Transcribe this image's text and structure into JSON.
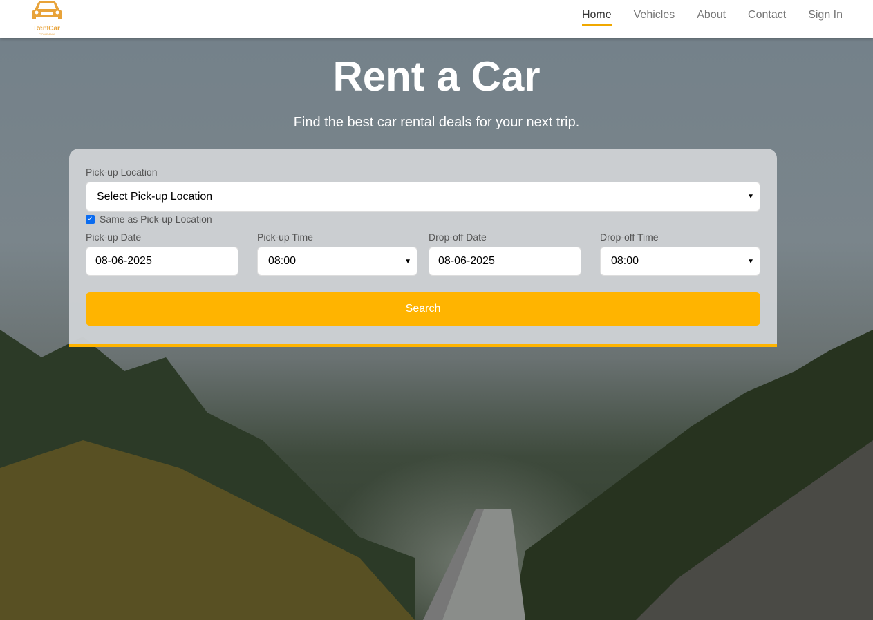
{
  "nav": {
    "logo_text_1": "Rent",
    "logo_text_2": "Car",
    "logo_sub": "COMPANY",
    "items": [
      {
        "label": "Home",
        "active": true
      },
      {
        "label": "Vehicles"
      },
      {
        "label": "About"
      },
      {
        "label": "Contact"
      },
      {
        "label": "Sign In"
      }
    ]
  },
  "hero": {
    "title": "Rent a Car",
    "subtitle": "Find the best car rental deals for your next trip."
  },
  "form": {
    "pickup_location_label": "Pick-up Location",
    "pickup_location_value": "Select Pick-up Location",
    "same_location_label": "Same as Pick-up Location",
    "same_location_checked": true,
    "pickup_date_label": "Pick-up Date",
    "pickup_date": "08-06-2025",
    "pickup_time_label": "Pick-up Time",
    "pickup_time": "08:00",
    "dropoff_date_label": "Drop-off Date",
    "dropoff_date": "08-06-2025",
    "dropoff_time_label": "Drop-off Time",
    "dropoff_time": "08:00",
    "search_label": "Search"
  },
  "colors": {
    "accent": "#ffb400",
    "logo": "#e8a33a"
  }
}
